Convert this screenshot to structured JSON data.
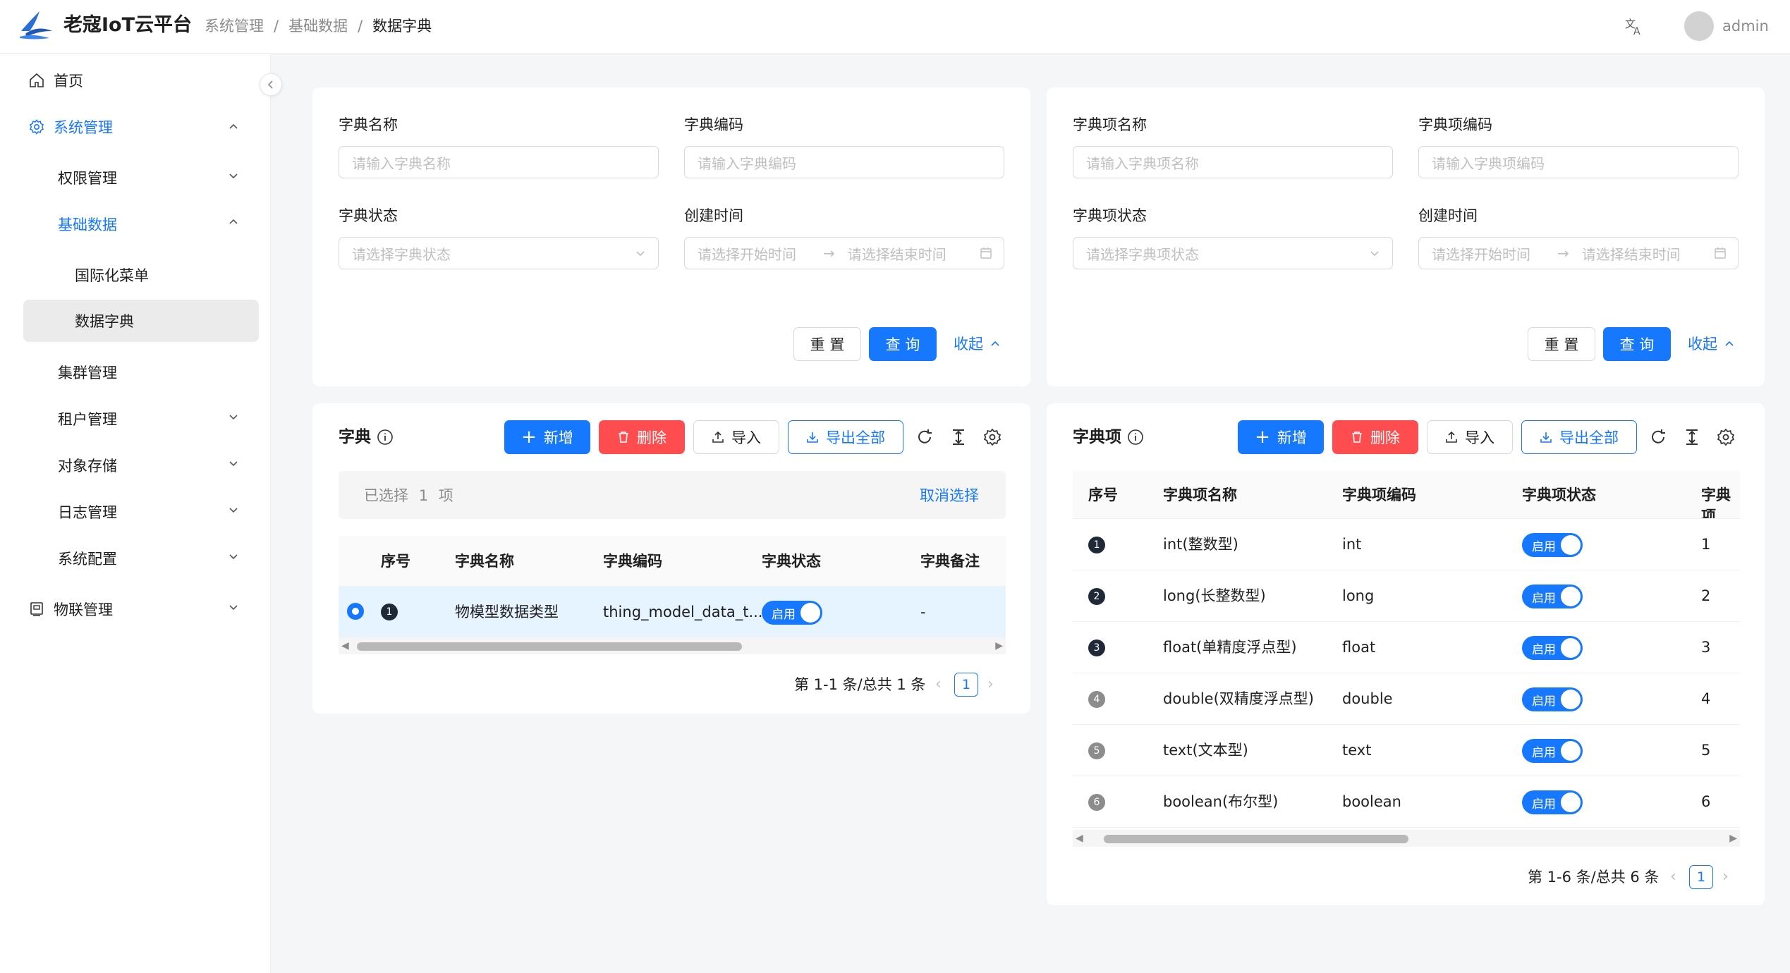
{
  "header": {
    "app_title": "老寇IoT云平台",
    "breadcrumb": [
      "系统管理",
      "基础数据",
      "数据字典"
    ],
    "breadcrumb_sep": "/",
    "user_name": "admin"
  },
  "sidebar": {
    "home": "首页",
    "system": "系统管理",
    "permission": "权限管理",
    "basic_data": "基础数据",
    "i18n_menu": "国际化菜单",
    "data_dict": "数据字典",
    "cluster": "集群管理",
    "tenant": "租户管理",
    "object_storage": "对象存储",
    "log": "日志管理",
    "sys_config": "系统配置",
    "iot": "物联管理"
  },
  "left_search": {
    "name_label": "字典名称",
    "name_placeholder": "请输入字典名称",
    "code_label": "字典编码",
    "code_placeholder": "请输入字典编码",
    "status_label": "字典状态",
    "status_placeholder": "请选择字典状态",
    "time_label": "创建时间",
    "start_placeholder": "请选择开始时间",
    "end_placeholder": "请选择结束时间",
    "reset": "重 置",
    "query": "查 询",
    "collapse": "收起"
  },
  "right_search": {
    "name_label": "字典项名称",
    "name_placeholder": "请输入字典项名称",
    "code_label": "字典项编码",
    "code_placeholder": "请输入字典项编码",
    "status_label": "字典项状态",
    "status_placeholder": "请选择字典项状态",
    "time_label": "创建时间",
    "start_placeholder": "请选择开始时间",
    "end_placeholder": "请选择结束时间",
    "reset": "重 置",
    "query": "查 询",
    "collapse": "收起"
  },
  "left_table": {
    "title": "字典",
    "add": "新增",
    "delete": "删除",
    "import": "导入",
    "export": "导出全部",
    "selection_text": "已选择",
    "selection_count": "1",
    "selection_unit": "项",
    "cancel_selection": "取消选择",
    "columns": [
      "序号",
      "字典名称",
      "字典编码",
      "字典状态",
      "字典备注"
    ],
    "rows": [
      {
        "no": "1",
        "name": "物模型数据类型",
        "code": "thing_model_data_t...",
        "status": "启用",
        "remark": "-"
      }
    ],
    "pagination_total": "第 1-1 条/总共 1 条",
    "page": "1"
  },
  "right_table": {
    "title": "字典项",
    "add": "新增",
    "delete": "删除",
    "import": "导入",
    "export": "导出全部",
    "columns": [
      "序号",
      "字典项名称",
      "字典项编码",
      "字典项状态",
      "字典项"
    ],
    "rows": [
      {
        "no": "1",
        "name": "int(整数型)",
        "code": "int",
        "status": "启用",
        "sort": "1"
      },
      {
        "no": "2",
        "name": "long(长整数型)",
        "code": "long",
        "status": "启用",
        "sort": "2"
      },
      {
        "no": "3",
        "name": "float(单精度浮点型)",
        "code": "float",
        "status": "启用",
        "sort": "3"
      },
      {
        "no": "4",
        "name": "double(双精度浮点型)",
        "code": "double",
        "status": "启用",
        "sort": "4"
      },
      {
        "no": "5",
        "name": "text(文本型)",
        "code": "text",
        "status": "启用",
        "sort": "5"
      },
      {
        "no": "6",
        "name": "boolean(布尔型)",
        "code": "boolean",
        "status": "启用",
        "sort": "6"
      }
    ],
    "pagination_total": "第 1-6 条/总共 6 条",
    "page": "1"
  },
  "colors": {
    "primary": "#1677ff",
    "danger": "#ff4d4f",
    "rank_dark": "#1f2937",
    "rank_gray": "#8c8c8c"
  }
}
